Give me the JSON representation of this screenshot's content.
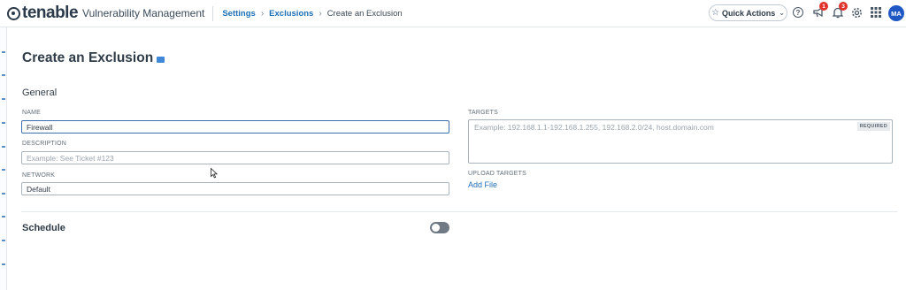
{
  "header": {
    "brand": "tenable",
    "product": "Vulnerability Management",
    "breadcrumbs": [
      {
        "label": "Settings"
      },
      {
        "label": "Exclusions"
      },
      {
        "label": "Create an Exclusion"
      }
    ],
    "quick_actions_label": "Quick Actions",
    "help_glyph": "?",
    "announcements_count": "1",
    "notifications_count": "3",
    "avatar_initials": "MA",
    "colors": {
      "brand_blue": "#1f6fb5",
      "badge_red": "#e0322a",
      "avatar_blue": "#1f58c4"
    }
  },
  "page": {
    "title": "Create an Exclusion",
    "general": {
      "title": "General",
      "name": {
        "label": "NAME",
        "value": "Firewall"
      },
      "description": {
        "label": "DESCRIPTION",
        "value": "",
        "placeholder": "Example: See Ticket #123"
      },
      "network": {
        "label": "NETWORK",
        "value": "Default"
      },
      "targets": {
        "label": "TARGETS",
        "placeholder": "Example: 192.168.1.1-192.168.1.255, 192.168.2.0/24, host.domain.com",
        "required_tag": "REQUIRED"
      },
      "upload": {
        "label": "UPLOAD TARGETS",
        "link": "Add File"
      }
    },
    "schedule": {
      "title": "Schedule",
      "enabled": false
    }
  },
  "icons": [
    "tenable-logo-icon",
    "star-icon",
    "chevron-down-icon",
    "help-icon",
    "megaphone-icon",
    "bell-icon",
    "gear-icon",
    "apps-grid-icon",
    "book-icon"
  ]
}
